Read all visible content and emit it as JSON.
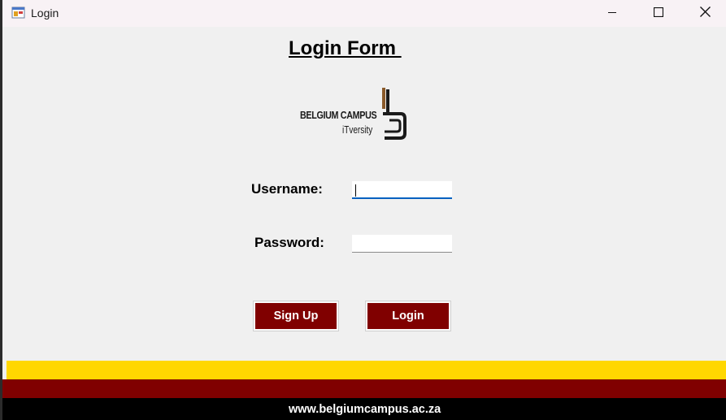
{
  "window": {
    "title": "Login",
    "controls": {
      "minimize_icon": "minimize-icon",
      "maximize_icon": "maximize-icon",
      "close_icon": "close-icon"
    }
  },
  "form": {
    "title": "Login Form ",
    "logo": {
      "name": "BELGIUM CAMPUS",
      "subtitle": "iTversity"
    },
    "username": {
      "label": "Username:",
      "value": ""
    },
    "password": {
      "label": "Password:",
      "value": ""
    },
    "signup_label": "Sign Up",
    "login_label": "Login"
  },
  "footer": {
    "url": "www.belgiumcampus.ac.za",
    "colors": {
      "yellow": "#ffd700",
      "maroon": "#800000",
      "black": "#000000"
    }
  },
  "colors": {
    "button_bg": "#800000",
    "button_text": "#ffffff",
    "focus_accent": "#0060c0"
  }
}
